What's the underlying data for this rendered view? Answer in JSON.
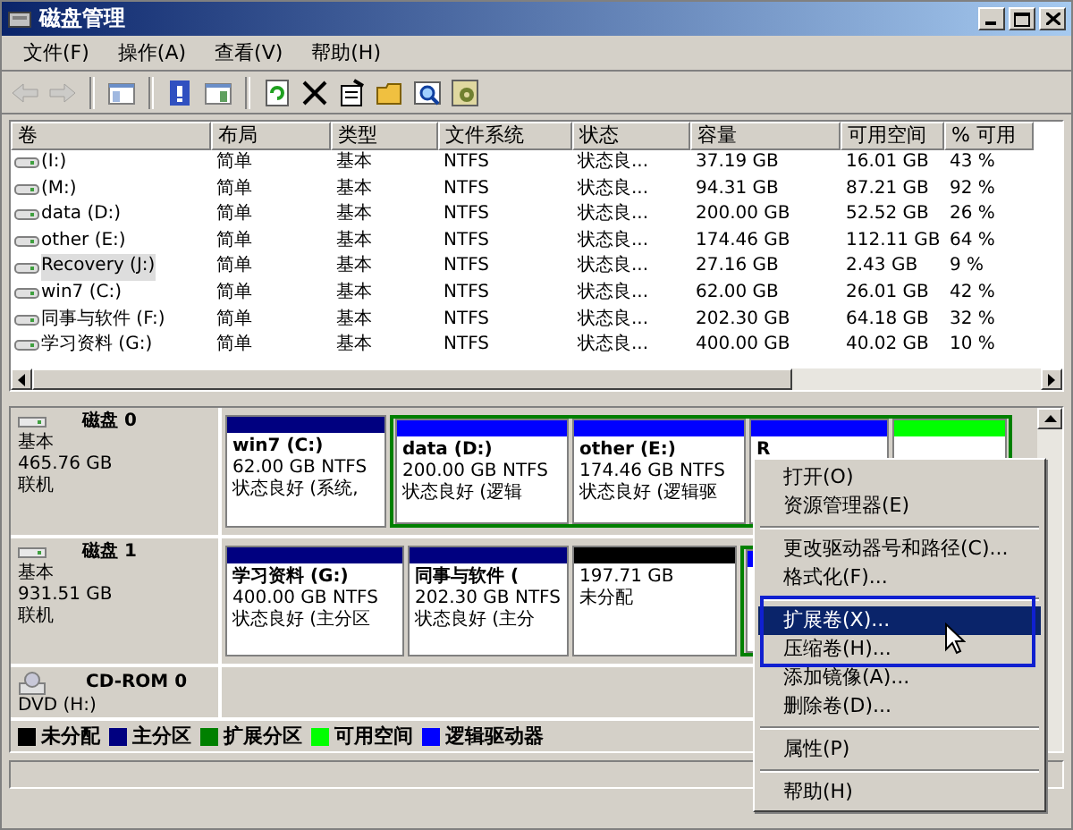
{
  "window": {
    "title": "磁盘管理"
  },
  "menu_bar": [
    "文件(F)",
    "操作(A)",
    "查看(V)",
    "帮助(H)"
  ],
  "toolbar": [
    {
      "kind": "back",
      "disabled": true
    },
    {
      "kind": "forward",
      "disabled": true
    },
    {
      "kind": "sep"
    },
    {
      "kind": "tree",
      "disabled": false
    },
    {
      "kind": "sep"
    },
    {
      "kind": "help",
      "disabled": false
    },
    {
      "kind": "panel",
      "disabled": false
    },
    {
      "kind": "sep"
    },
    {
      "kind": "refresh",
      "disabled": false
    },
    {
      "kind": "delete",
      "disabled": false
    },
    {
      "kind": "properties",
      "disabled": false
    },
    {
      "kind": "folder",
      "disabled": false
    },
    {
      "kind": "search",
      "disabled": false
    },
    {
      "kind": "settings",
      "disabled": false
    }
  ],
  "volume_table": {
    "columns": [
      "卷",
      "布局",
      "类型",
      "文件系统",
      "状态",
      "容量",
      "可用空间",
      "% 可用"
    ],
    "rows": [
      {
        "selected": false,
        "cells": [
          "(I:)",
          "简单",
          "基本",
          "NTFS",
          "状态良...",
          "37.19 GB",
          "16.01 GB",
          "43 %"
        ]
      },
      {
        "selected": false,
        "cells": [
          "(M:)",
          "简单",
          "基本",
          "NTFS",
          "状态良...",
          "94.31 GB",
          "87.21 GB",
          "92 %"
        ]
      },
      {
        "selected": false,
        "cells": [
          "data (D:)",
          "简单",
          "基本",
          "NTFS",
          "状态良...",
          "200.00 GB",
          "52.52 GB",
          "26 %"
        ]
      },
      {
        "selected": false,
        "cells": [
          "other (E:)",
          "简单",
          "基本",
          "NTFS",
          "状态良...",
          "174.46 GB",
          "112.11 GB",
          "64 %"
        ]
      },
      {
        "selected": true,
        "cells": [
          "Recovery (J:)",
          "简单",
          "基本",
          "NTFS",
          "状态良...",
          "27.16 GB",
          "2.43 GB",
          "9 %"
        ]
      },
      {
        "selected": false,
        "cells": [
          "win7 (C:)",
          "简单",
          "基本",
          "NTFS",
          "状态良...",
          "62.00 GB",
          "26.01 GB",
          "42 %"
        ]
      },
      {
        "selected": false,
        "cells": [
          "同事与软件 (F:)",
          "简单",
          "基本",
          "NTFS",
          "状态良...",
          "202.30 GB",
          "64.18 GB",
          "32 %"
        ]
      },
      {
        "selected": false,
        "cells": [
          "学习资料 (G:)",
          "简单",
          "基本",
          "NTFS",
          "状态良...",
          "400.00 GB",
          "40.02 GB",
          "10 %"
        ]
      }
    ]
  },
  "disks": [
    {
      "kind": "disk",
      "name": "磁盘 0",
      "type": "基本",
      "size": "465.76 GB",
      "state": "联机",
      "partitions": [
        {
          "kind": "primary",
          "extended": false,
          "label": "win7 (C:)",
          "size": "62.00 GB NTFS",
          "status": "状态良好 (系统,"
        },
        {
          "kind": "logical",
          "extended": true,
          "label": "data (D:)",
          "size": "200.00 GB NTFS",
          "status": "状态良好 (逻辑"
        },
        {
          "kind": "logical",
          "extended": true,
          "label": "other (E:)",
          "size": "174.46 GB NTFS",
          "status": "状态良好 (逻辑驱"
        },
        {
          "kind": "logical",
          "extended": true,
          "label": "R"
        },
        {
          "kind": "free",
          "extended": true
        }
      ]
    },
    {
      "kind": "disk",
      "name": "磁盘 1",
      "type": "基本",
      "size": "931.51 GB",
      "state": "联机",
      "partitions": [
        {
          "kind": "primary",
          "extended": false,
          "label": "学习资料 (G:)",
          "size": "400.00 GB NTFS",
          "status": "状态良好 (主分区"
        },
        {
          "kind": "primary",
          "extended": false,
          "label": "同事与软件 (",
          "size": "202.30 GB NTFS",
          "status": "状态良好 (主分"
        },
        {
          "kind": "unallocated",
          "extended": false,
          "size": "197.71 GB",
          "status": "未分配"
        },
        {
          "kind": "logical",
          "extended": true
        }
      ]
    },
    {
      "kind": "cdrom",
      "name": "CD-ROM 0",
      "type": "DVD (H:)"
    }
  ],
  "legend": [
    {
      "label": "未分配",
      "color": "#000000"
    },
    {
      "label": "主分区",
      "color": "#000080"
    },
    {
      "label": "扩展分区",
      "color": "#008000"
    },
    {
      "label": "可用空间",
      "color": "#00ff00"
    },
    {
      "label": "逻辑驱动器",
      "color": "#0000ff"
    }
  ],
  "context_menu": [
    {
      "kind": "item",
      "label": "打开(O)",
      "selected": false
    },
    {
      "kind": "item",
      "label": "资源管理器(E)",
      "selected": false
    },
    {
      "kind": "sep"
    },
    {
      "kind": "item",
      "label": "更改驱动器号和路径(C)...",
      "selected": false
    },
    {
      "kind": "item",
      "label": "格式化(F)...",
      "selected": false
    },
    {
      "kind": "sep"
    },
    {
      "kind": "item",
      "label": "扩展卷(X)...",
      "selected": true
    },
    {
      "kind": "item",
      "label": "压缩卷(H)...",
      "selected": false
    },
    {
      "kind": "item",
      "label": "添加镜像(A)...",
      "selected": false
    },
    {
      "kind": "item",
      "label": "删除卷(D)...",
      "selected": false
    },
    {
      "kind": "sep"
    },
    {
      "kind": "item",
      "label": "属性(P)",
      "selected": false
    },
    {
      "kind": "sep"
    },
    {
      "kind": "item",
      "label": "帮助(H)",
      "selected": false
    }
  ]
}
